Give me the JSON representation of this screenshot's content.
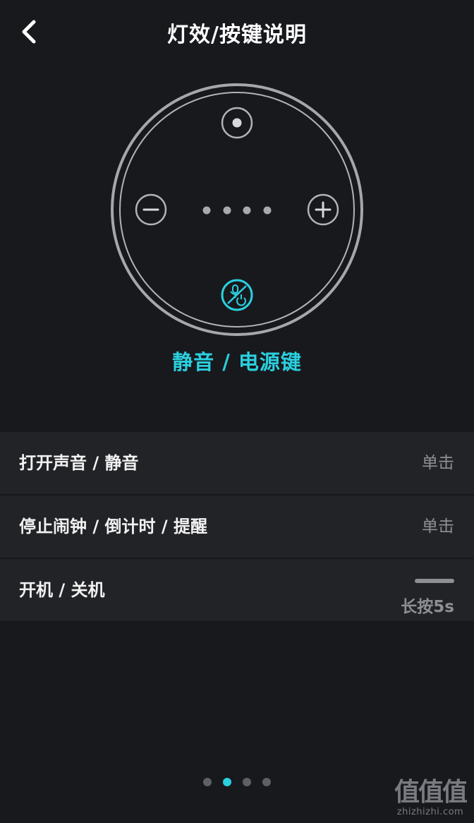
{
  "header": {
    "title": "灯效/按键说明",
    "back_icon": "chevron-left-icon"
  },
  "device": {
    "highlighted_button_label": "静音 / 电源键",
    "accent_color": "#2ad0df",
    "icons": {
      "top": "action-button-icon",
      "left": "volume-down-icon",
      "right": "volume-up-icon",
      "bottom": "mute-power-icon"
    },
    "led_count": 4
  },
  "functions": [
    {
      "label": "打开声音 / 静音",
      "action": "单击"
    },
    {
      "label": "停止闹钟 / 倒计时 / 提醒",
      "action": "单击"
    },
    {
      "label": "开机 / 关机",
      "action": "长按5s"
    }
  ],
  "pager": {
    "total": 4,
    "current": 2
  },
  "watermark": {
    "logo_text": "值值值",
    "site": "zhizhizhi.com"
  }
}
